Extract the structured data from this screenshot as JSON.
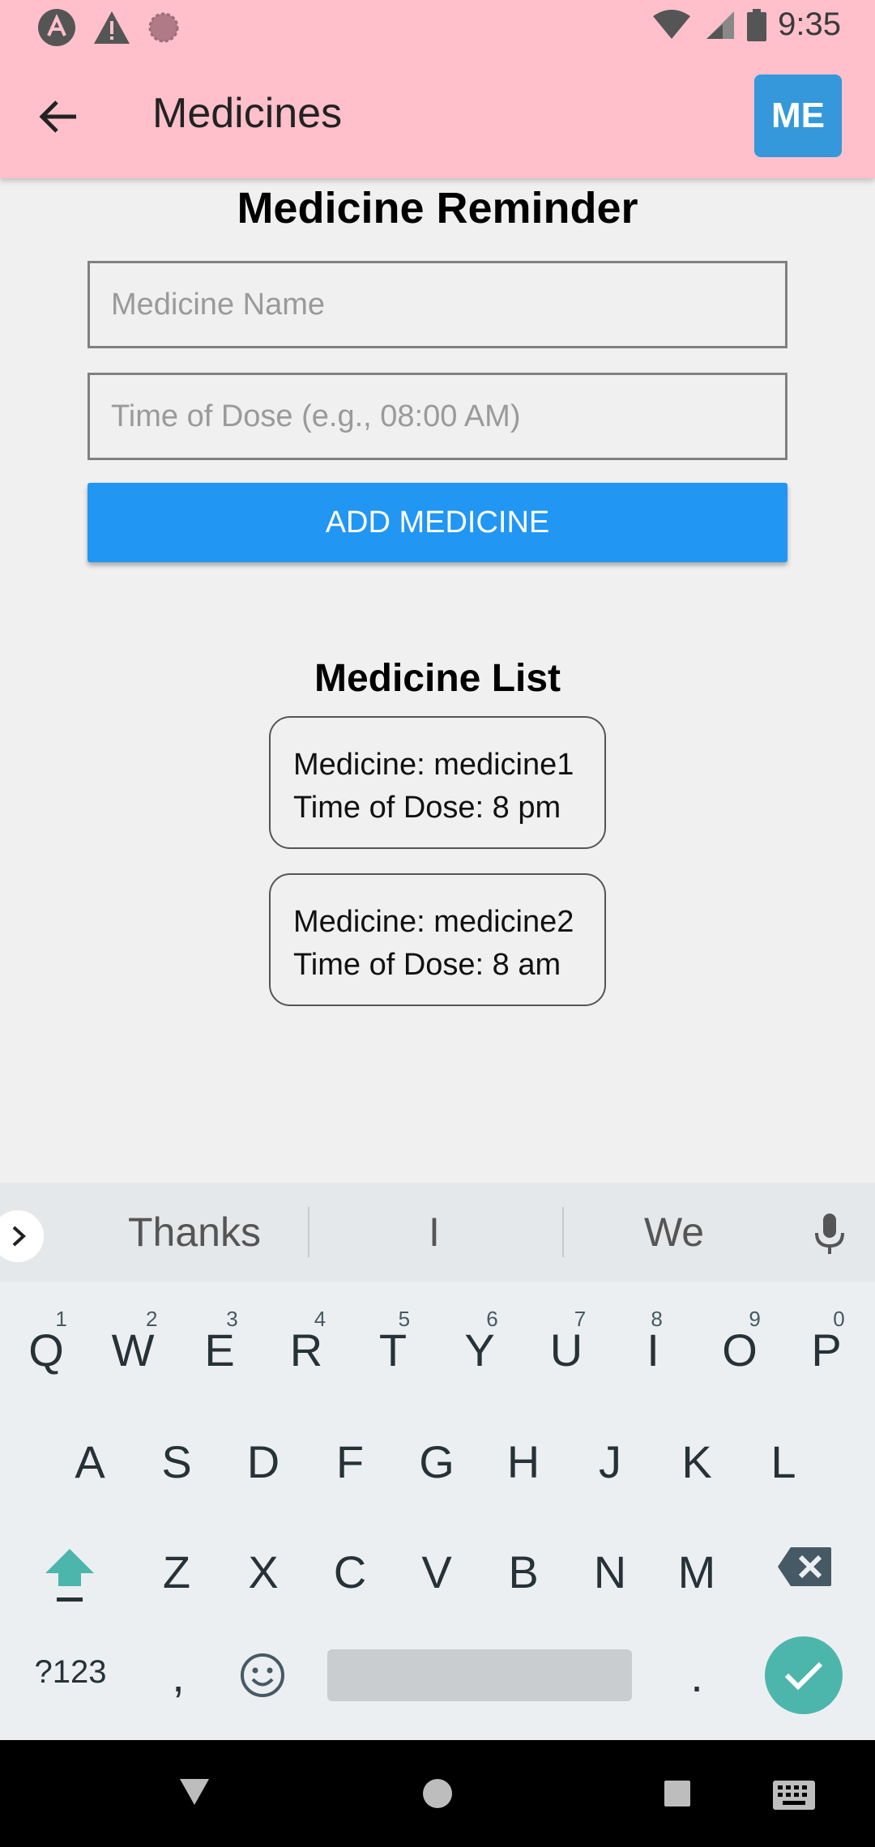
{
  "status_bar": {
    "time": "9:35",
    "left_icons": [
      "app-icon",
      "warning-icon",
      "sync-icon"
    ],
    "right_icons": [
      "wifi-icon",
      "signal-icon",
      "battery-icon"
    ]
  },
  "app_bar": {
    "title": "Medicines",
    "back_icon": "arrow-left-icon",
    "action_label": "ME",
    "background": "#ffc0cb",
    "action_color": "#3498db"
  },
  "form": {
    "heading": "Medicine Reminder",
    "medicine_name": {
      "value": "",
      "placeholder": "Medicine Name"
    },
    "time_of_dose": {
      "value": "",
      "placeholder": "Time of Dose (e.g., 08:00 AM)"
    },
    "add_button": "ADD MEDICINE",
    "add_button_color": "#2196f3"
  },
  "list": {
    "heading": "Medicine List",
    "items": [
      {
        "medicine": "Medicine: medicine1",
        "time": "Time of Dose: 8 pm"
      },
      {
        "medicine": "Medicine: medicine2",
        "time": "Time of Dose: 8 am"
      }
    ]
  },
  "keyboard": {
    "suggestions": [
      "Thanks",
      "I",
      "We"
    ],
    "row1": [
      {
        "k": "Q",
        "n": "1"
      },
      {
        "k": "W",
        "n": "2"
      },
      {
        "k": "E",
        "n": "3"
      },
      {
        "k": "R",
        "n": "4"
      },
      {
        "k": "T",
        "n": "5"
      },
      {
        "k": "Y",
        "n": "6"
      },
      {
        "k": "U",
        "n": "7"
      },
      {
        "k": "I",
        "n": "8"
      },
      {
        "k": "O",
        "n": "9"
      },
      {
        "k": "P",
        "n": "0"
      }
    ],
    "row2": [
      "A",
      "S",
      "D",
      "F",
      "G",
      "H",
      "J",
      "K",
      "L"
    ],
    "row3": [
      "Z",
      "X",
      "C",
      "V",
      "B",
      "N",
      "M"
    ],
    "bottom": {
      "symbols": "?123",
      "comma": ",",
      "period": "."
    },
    "enter_color": "#4db6ac"
  },
  "nav_bar": {
    "icons": [
      "back-triangle-icon",
      "home-circle-icon",
      "recents-square-icon",
      "keyboard-icon"
    ]
  }
}
